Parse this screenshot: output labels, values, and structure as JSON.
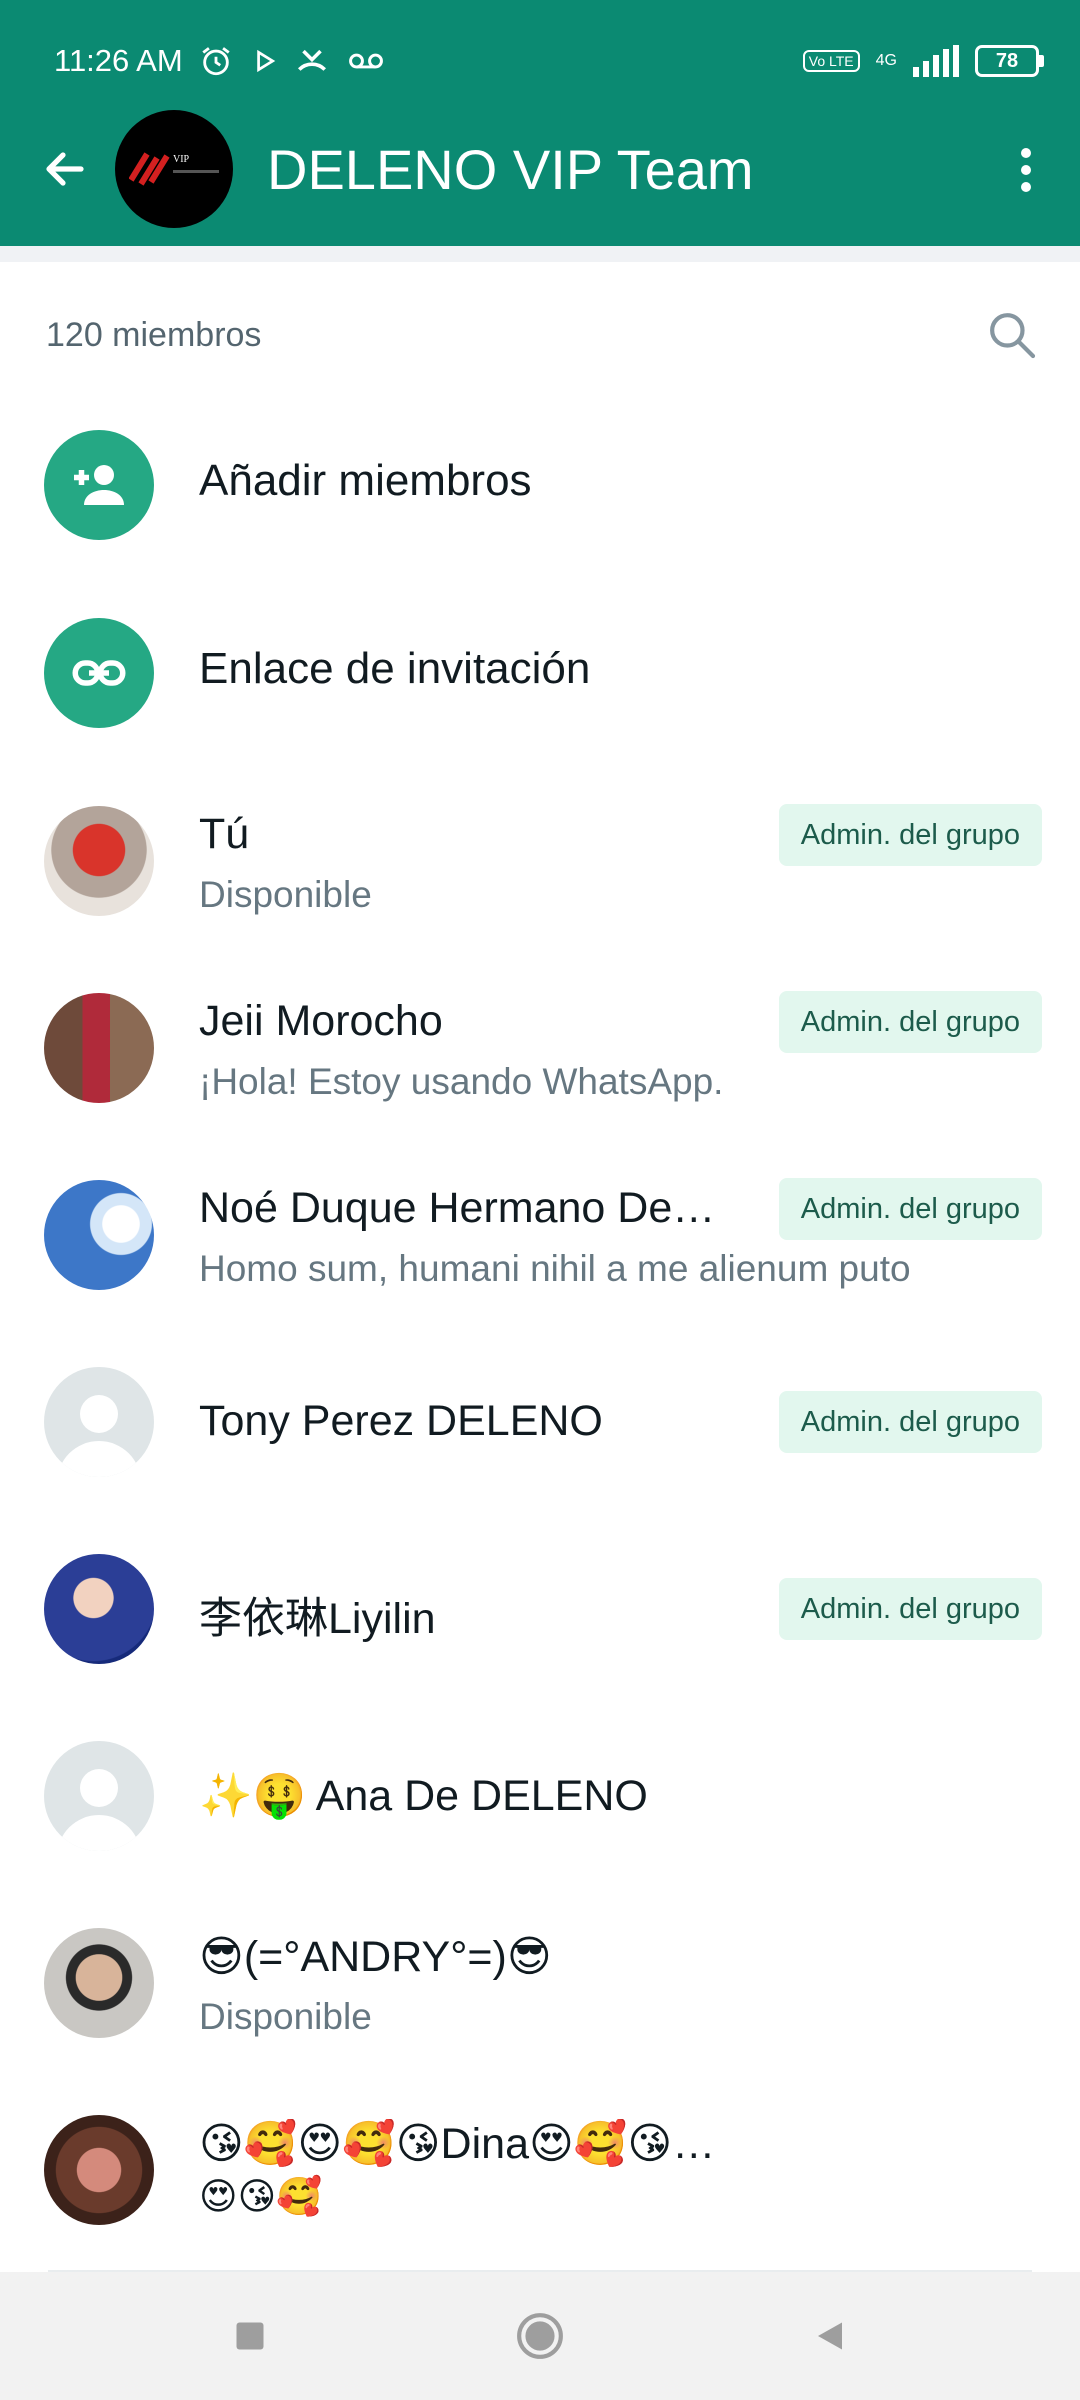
{
  "status_bar": {
    "time": "11:26 AM",
    "volte_label": "Vo LTE",
    "network": "4G",
    "battery": "78"
  },
  "header": {
    "title": "DELENO VIP Team",
    "avatar_text": "VIP"
  },
  "members": {
    "count_label": "120 miembros"
  },
  "actions": [
    {
      "label": "Añadir miembros",
      "icon": "add-person-icon"
    },
    {
      "label": "Enlace de invitación",
      "icon": "link-icon"
    }
  ],
  "participants": [
    {
      "name": "Tú",
      "about": "Disponible",
      "badge": "Admin. del grupo"
    },
    {
      "name": "Jeii Morocho",
      "about": "¡Hola! Estoy usando WhatsApp.",
      "badge": "Admin. del grupo"
    },
    {
      "name": "Noé Duque Hermano De…",
      "about": "Homo sum, humani nihil a me alienum puto",
      "badge": "Admin. del grupo"
    },
    {
      "name": "Tony Perez DELENO",
      "badge": "Admin. del grupo"
    },
    {
      "name": "李依琳Liyilin",
      "badge": "Admin. del grupo"
    },
    {
      "name": "✨🤑 Ana De DELENO"
    },
    {
      "name": "😎(=°ANDRY°=)😎",
      "about": "Disponible"
    },
    {
      "name": "😘🥰😍🥰😘Dina😍🥰😘😍🥰",
      "about": "😍😘🥰"
    }
  ],
  "colors": {
    "header": "#0b8a72",
    "accent": "#25a884",
    "badge_bg": "#e2f7ee",
    "badge_text": "#1c5b4b"
  }
}
